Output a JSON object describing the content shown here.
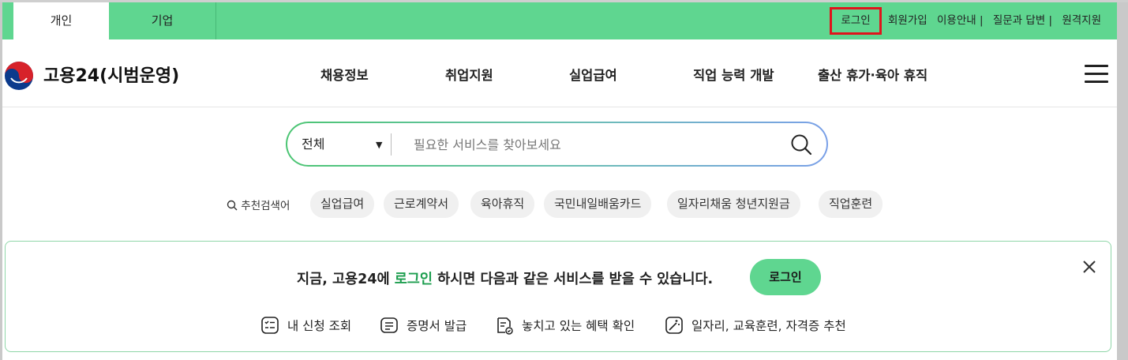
{
  "topbar": {
    "tabs": [
      "개인",
      "기업"
    ],
    "login": "로그인",
    "links": [
      "회원가입",
      "이용안내 |",
      "질문과 답변 |",
      "원격지원"
    ]
  },
  "header": {
    "logo_text": "고용24(시범운영)",
    "nav": [
      "채용정보",
      "취업지원",
      "실업급여",
      "직업 능력 개발",
      "출산 휴가·육아 휴직"
    ]
  },
  "search": {
    "category": "전체",
    "placeholder": "필요한 서비스를 찾아보세요"
  },
  "recommended": {
    "label": "추천검색어",
    "keywords": [
      "실업급여",
      "근로계약서",
      "육아휴직",
      "국민내일배움카드",
      "일자리채움 청년지원금",
      "직업훈련"
    ]
  },
  "login_panel": {
    "message_pre": "지금, 고용24에 ",
    "message_hl": "로그인",
    "message_post": " 하시면 다음과 같은 서비스를 받을 수 있습니다.",
    "button": "로그인",
    "services": [
      "내 신청 조회",
      "증명서 발급",
      "놓치고 있는 혜택 확인",
      "일자리, 교육훈련, 자격증 추천"
    ]
  },
  "colors": {
    "topbar": "#5fd690",
    "highlight": "#1d9e4f",
    "login_outline": "#e0141c"
  }
}
